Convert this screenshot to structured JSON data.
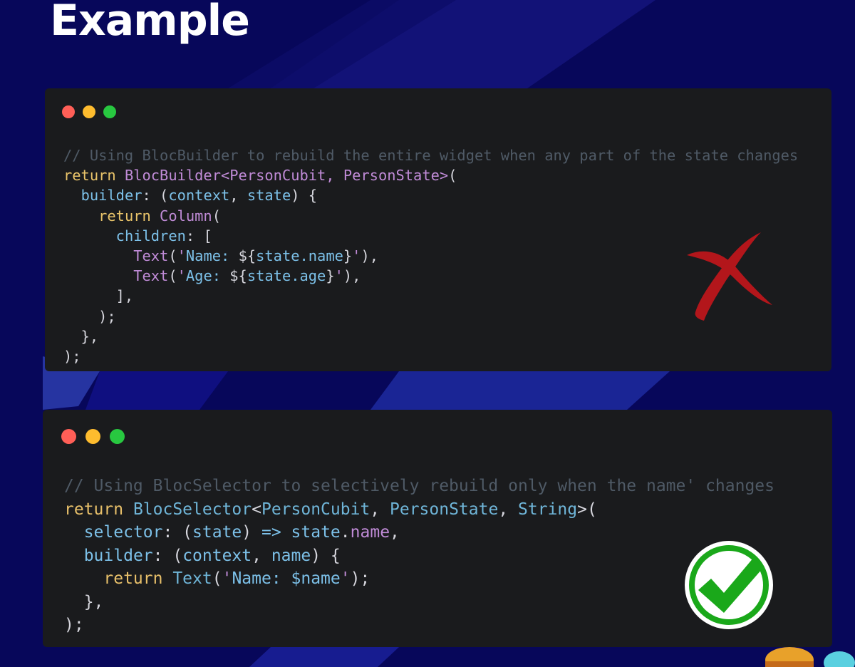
{
  "page": {
    "title": "Example"
  },
  "windows": [
    {
      "id": "blocbuilder-example",
      "verdict": "bad",
      "comment": "// Using BlocBuilder to rebuild the entire widget when any part of the state changes",
      "lines": [
        [
          [
            "kw",
            "return "
          ],
          [
            "ty",
            "BlocBuilder"
          ],
          [
            "gen",
            "<PersonCubit, PersonState>"
          ],
          [
            "p",
            "("
          ]
        ],
        [
          [
            "p",
            "  "
          ],
          [
            "prop",
            "builder"
          ],
          [
            "p",
            ": ("
          ],
          [
            "prop",
            "context"
          ],
          [
            "p",
            ", "
          ],
          [
            "prop",
            "state"
          ],
          [
            "p",
            ") {"
          ]
        ],
        [
          [
            "p",
            "    "
          ],
          [
            "kw",
            "return "
          ],
          [
            "ty",
            "Column"
          ],
          [
            "p",
            "("
          ]
        ],
        [
          [
            "p",
            "      "
          ],
          [
            "prop",
            "children"
          ],
          [
            "p",
            ": ["
          ]
        ],
        [
          [
            "p",
            "        "
          ],
          [
            "ty",
            "Text"
          ],
          [
            "p",
            "("
          ],
          [
            "q",
            "'"
          ],
          [
            "str",
            "Name: "
          ],
          [
            "p",
            "${"
          ],
          [
            "prop",
            "state.name"
          ],
          [
            "p",
            "}"
          ],
          [
            "q",
            "'"
          ],
          [
            "p",
            "),"
          ]
        ],
        [
          [
            "p",
            "        "
          ],
          [
            "ty",
            "Text"
          ],
          [
            "p",
            "("
          ],
          [
            "q",
            "'"
          ],
          [
            "str",
            "Age: "
          ],
          [
            "p",
            "${"
          ],
          [
            "prop",
            "state.age"
          ],
          [
            "p",
            "}"
          ],
          [
            "q",
            "'"
          ],
          [
            "p",
            "),"
          ]
        ],
        [
          [
            "p",
            "      ],"
          ]
        ],
        [
          [
            "p",
            "    );"
          ]
        ],
        [
          [
            "p",
            "  },"
          ]
        ],
        [
          [
            "p",
            ");"
          ]
        ]
      ]
    },
    {
      "id": "blocselector-example",
      "verdict": "good",
      "comment": "// Using BlocSelector to selectively rebuild only when the name' changes",
      "lines": [
        [
          [
            "kw",
            "return "
          ],
          [
            "ty",
            "BlocSelector"
          ],
          [
            "p",
            "<"
          ],
          [
            "ty",
            "PersonCubit"
          ],
          [
            "p",
            ", "
          ],
          [
            "ty",
            "PersonState"
          ],
          [
            "p",
            ", "
          ],
          [
            "ty",
            "String"
          ],
          [
            "p",
            ">("
          ]
        ],
        [
          [
            "p",
            "  "
          ],
          [
            "prop",
            "selector"
          ],
          [
            "p",
            ": ("
          ],
          [
            "prop",
            "state"
          ],
          [
            "p",
            ") "
          ],
          [
            "prop",
            "=>"
          ],
          [
            "p",
            " "
          ],
          [
            "prop",
            "state"
          ],
          [
            "p",
            "."
          ],
          [
            "gen",
            "name"
          ],
          [
            "p",
            ","
          ]
        ],
        [
          [
            "p",
            "  "
          ],
          [
            "prop",
            "builder"
          ],
          [
            "p",
            ": ("
          ],
          [
            "prop",
            "context"
          ],
          [
            "p",
            ", "
          ],
          [
            "prop",
            "name"
          ],
          [
            "p",
            ") {"
          ]
        ],
        [
          [
            "p",
            "    "
          ],
          [
            "kw",
            "return "
          ],
          [
            "ty",
            "Text"
          ],
          [
            "p",
            "("
          ],
          [
            "q",
            "'"
          ],
          [
            "str",
            "Name: $name"
          ],
          [
            "q",
            "'"
          ],
          [
            "p",
            ");"
          ]
        ],
        [
          [
            "p",
            "  },"
          ]
        ],
        [
          [
            "p",
            ");"
          ]
        ]
      ]
    }
  ],
  "icons": {
    "window_controls": [
      "close-dot",
      "minimize-dot",
      "maximize-dot"
    ],
    "bad_mark": "red-x-icon",
    "good_mark": "green-check-icon"
  },
  "colors": {
    "background": "#07075a",
    "window": "#1a1b1d",
    "comment": "#4f5a66",
    "keyword": "#e8c06a",
    "type": "#6fb5d8",
    "generic": "#c08bd7",
    "bad": "#b3161b",
    "good": "#1aa81a"
  }
}
